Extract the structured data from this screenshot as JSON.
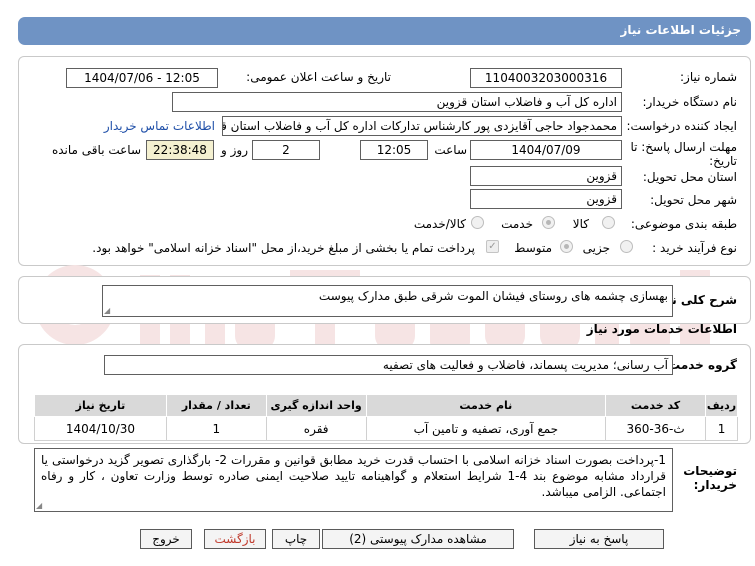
{
  "header": {
    "title": "جزئیات اطلاعات نیاز"
  },
  "form": {
    "need_number_label": "شماره نیاز:",
    "need_number": "1104003203000316",
    "announce_label": "تاریخ و ساعت اعلان عمومی:",
    "announce_value": "1404/07/06 - 12:05",
    "buyer_org_label": "نام دستگاه خریدار:",
    "buyer_org": "اداره کل آب و فاضلاب استان قزوین",
    "creator_label": "ایجاد کننده درخواست:",
    "creator": "محمدجواد حاجی آقایزدی پور کارشناس تدارکات اداره کل آب و فاضلاب استان قزوین",
    "contact_link": "اطلاعات تماس خریدار",
    "deadline_label_1": "مهلت ارسال پاسخ: تا",
    "deadline_label_2": "تاریخ:",
    "deadline_date": "1404/07/09",
    "time_label": "ساعت",
    "deadline_time": "12:05",
    "days": "2",
    "days_label": "روز و",
    "remaining_time": "22:38:48",
    "remaining_label": "ساعت باقی مانده",
    "province_label": "استان محل تحویل:",
    "province": "قزوین",
    "city_label": "شهر محل تحویل:",
    "city": "قزوین",
    "category_label": "طبقه بندی موضوعی:",
    "category_options": [
      "کالا",
      "خدمت",
      "کالا/خدمت"
    ],
    "process_label": "نوع فرآیند خرید :",
    "process_options": [
      "جزیی",
      "متوسط"
    ],
    "treasury_note": "پرداخت تمام یا بخشی از مبلغ خرید،از محل \"اسناد خزانه اسلامی\" خواهد بود."
  },
  "description": {
    "label": "شرح کلی نیاز:",
    "value": "بهسازی چشمه های روستای فیشان الموت شرقی طبق مدارک پیوست"
  },
  "services": {
    "section_title": "اطلاعات خدمات مورد نیاز",
    "group_label": "گروه خدمت:",
    "group_value": "آب رسانی؛ مدیریت پسماند، فاضلاب و فعالیت های تصفیه"
  },
  "table": {
    "headers": [
      "ردیف",
      "کد خدمت",
      "نام خدمت",
      "واحد اندازه گیری",
      "تعداد / مقدار",
      "تاریخ نیاز"
    ],
    "rows": [
      [
        "1",
        "ث-36-360",
        "جمع آوری، تصفیه و تامین آب",
        "فقره",
        "1",
        "1404/10/30"
      ]
    ]
  },
  "buyer_notes": {
    "label_1": "توضیحات",
    "label_2": "خریدار:",
    "value": "1-پرداخت بصورت اسناد خزانه اسلامی با احتساب قدرت خرید مطابق قوانین و مقررات 2- بارگذاری تصویر گزید درخواستی یا قرارداد مشابه موضوع بند 4-1 شرایط استعلام و گواهینامه تایید صلاحیت ایمنی صادره توسط وزارت تعاون ، کار و رفاه اجتماعی. الزامی میباشد."
  },
  "buttons": {
    "reply": "پاسخ به نیاز",
    "attachments": "مشاهده مدارک پیوستی (2)",
    "print": "چاپ",
    "back": "بازگشت",
    "exit": "خروج"
  },
  "colors": {
    "header_bg": "#6f93c4",
    "timer_bg": "#f4f0d0",
    "link": "#1f4fa8",
    "back_text": "#c0392b"
  },
  "icons": {
    "checkbox": "checkmark-icon",
    "radio": "radio-icon"
  }
}
